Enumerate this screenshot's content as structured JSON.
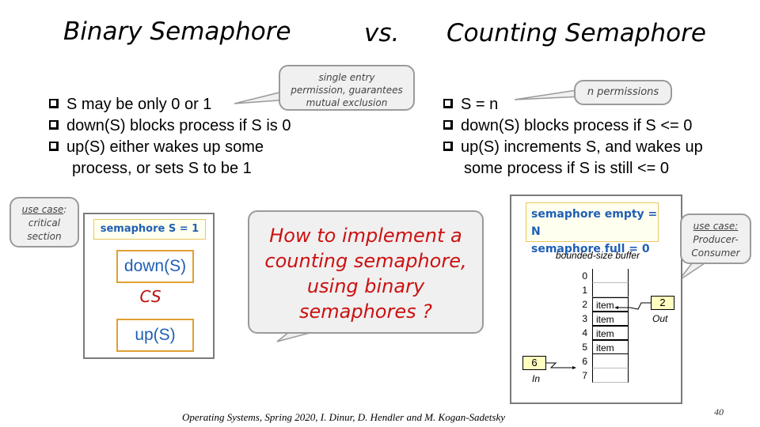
{
  "slide": {
    "title_left": "Binary Semaphore",
    "title_vs": "vs.",
    "title_right": "Counting Semaphore",
    "binary": {
      "bullets": [
        "S may be only 0 or 1",
        "down(S) blocks process if S is 0",
        "up(S) either wakes up some",
        "process, or sets S to be 1"
      ],
      "callout_lines": [
        "single entry",
        "permission, guarantees",
        "mutual exclusion"
      ],
      "use_case_label": "use case",
      "use_case_colon": ":",
      "use_case_lines": [
        "critical",
        "section"
      ],
      "example": {
        "semaphore_decl": "semaphore S = 1",
        "down": "down(S)",
        "cs": "CS",
        "up": "up(S)"
      }
    },
    "counting": {
      "bullets": [
        "S = n",
        "down(S) blocks process if S <= 0",
        "up(S) increments S, and wakes up",
        "some process if S is still <= 0"
      ],
      "callout": "n permissions",
      "use_case_label": "use case:",
      "use_case_lines": [
        "Producer-",
        "Consumer"
      ],
      "example": {
        "decl_empty": "semaphore empty = N",
        "decl_full": "semaphore full = 0",
        "buffer_title": "bounded-size buffer",
        "slots": [
          {
            "index": "0",
            "value": ""
          },
          {
            "index": "1",
            "value": ""
          },
          {
            "index": "2",
            "value": "item"
          },
          {
            "index": "3",
            "value": "item"
          },
          {
            "index": "4",
            "value": "item"
          },
          {
            "index": "5",
            "value": "item"
          },
          {
            "index": "6",
            "value": ""
          },
          {
            "index": "7",
            "value": ""
          }
        ],
        "out_value": "2",
        "out_label": "Out",
        "in_value": "6",
        "in_label": "In"
      }
    },
    "question": [
      "How to implement a",
      "counting semaphore,",
      "using binary",
      "semaphores ?"
    ],
    "footer": "Operating Systems, Spring 2020, I. Dinur, D. Hendler and M. Kogan-Sadetsky",
    "page_number": "40",
    "colors": {
      "accent_blue": "#1f5fb4",
      "question_red": "#cc1111",
      "cs_red": "#bb1111",
      "callout_bg": "#f0f0f0",
      "box_border": "#e0a030"
    }
  }
}
